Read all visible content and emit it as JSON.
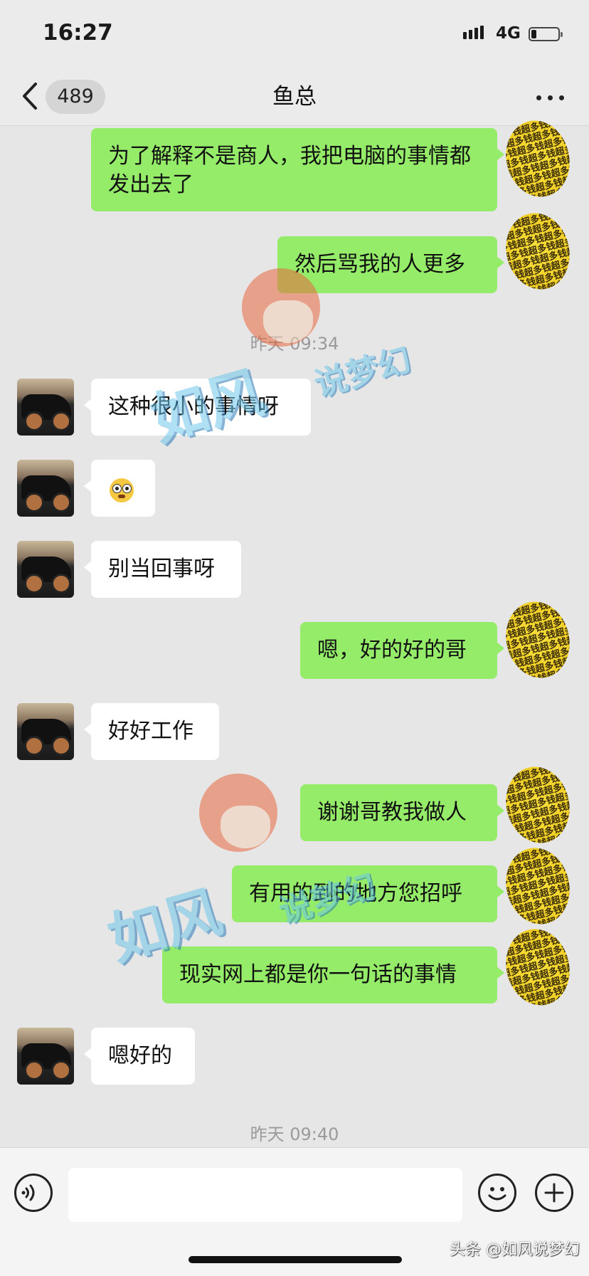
{
  "status_bar": {
    "time": "16:27",
    "network": "4G"
  },
  "nav": {
    "unread_count": "489",
    "title": "鱼总",
    "back_icon": "chevron-left-icon",
    "more_icon": "more-dots-icon"
  },
  "messages": [
    {
      "side": "out",
      "text": "为了解释不是商人，我把电脑的事情都发出去了"
    },
    {
      "side": "out",
      "text": "然后骂我的人更多"
    },
    {
      "type": "time",
      "text": "昨天 09:34"
    },
    {
      "side": "in",
      "text": "这种很小的事情呀"
    },
    {
      "side": "in",
      "emoji": "shocked-face-emoji"
    },
    {
      "side": "in",
      "text": "别当回事呀"
    },
    {
      "side": "out",
      "text": "嗯，好的好的哥"
    },
    {
      "side": "in",
      "text": "好好工作"
    },
    {
      "side": "out",
      "text": "谢谢哥教我做人"
    },
    {
      "side": "out",
      "text": "有用的到的地方您招呼"
    },
    {
      "side": "out",
      "text": "现实网上都是你一句话的事情"
    },
    {
      "side": "in",
      "text": "嗯好的"
    },
    {
      "type": "time",
      "text": "昨天 09:40"
    }
  ],
  "avatar_pattern_text": "超多钱",
  "watermark": {
    "main": "如风",
    "sub": "说梦幻"
  },
  "input": {
    "placeholder": "",
    "voice_icon": "voice-icon",
    "emoji_icon": "emoji-icon",
    "plus_icon": "plus-icon"
  },
  "source_mark": "头条 @如风说梦幻",
  "colors": {
    "outgoing_bubble": "#95ec69",
    "incoming_bubble": "#ffffff",
    "background": "#e6e6e6"
  }
}
